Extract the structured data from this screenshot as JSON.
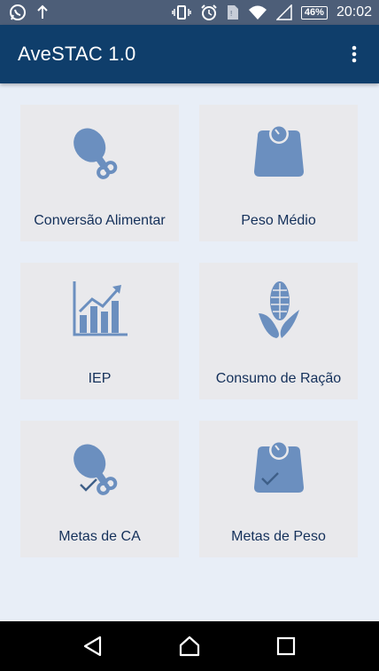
{
  "status_bar": {
    "battery": "46%",
    "time": "20:02",
    "icons": [
      "whatsapp-icon",
      "upload-icon",
      "vibrate-icon",
      "alarm-icon",
      "sim-icon",
      "wifi-icon",
      "signal-icon",
      "battery-icon"
    ]
  },
  "app_bar": {
    "title": "AveSTAC 1.0",
    "menu_icon": "more-vert-icon"
  },
  "tiles": [
    {
      "label": "Conversão Alimentar",
      "icon": "drumstick-icon"
    },
    {
      "label": "Peso Médio",
      "icon": "scale-icon"
    },
    {
      "label": "IEP",
      "icon": "bar-chart-icon"
    },
    {
      "label": "Consumo de Ração",
      "icon": "corn-icon"
    },
    {
      "label": "Metas de CA",
      "icon": "drumstick-check-icon"
    },
    {
      "label": "Metas de Peso",
      "icon": "scale-check-icon"
    }
  ],
  "nav_bar": {
    "icons": [
      "back-icon",
      "home-icon",
      "recents-icon"
    ]
  },
  "colors": {
    "app_bar": "#0f3e6b",
    "status_bar": "#4d5e78",
    "background": "#e8eef7",
    "tile": "#e9e9ec",
    "icon": "#6b8fbf",
    "label": "#14305a"
  }
}
